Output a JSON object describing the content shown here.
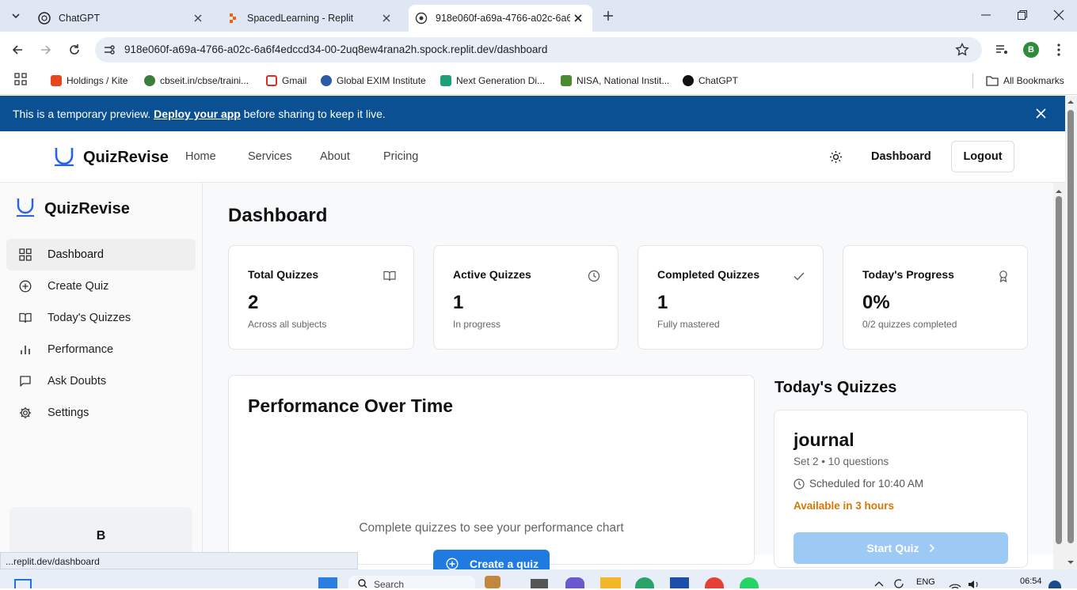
{
  "browser": {
    "tabs": [
      {
        "title": "ChatGPT",
        "icon": "chatgpt-icon"
      },
      {
        "title": "SpacedLearning - Replit",
        "icon": "replit-icon"
      },
      {
        "title": "918e060f-a69a-4766-a02c-6a6",
        "icon": "globe-icon"
      }
    ],
    "url": "918e060f-a69a-4766-a02c-6a6f4edccd34-00-2uq8ew4rana2h.spock.replit.dev/dashboard",
    "profile_initial": "B",
    "bookmarks": [
      {
        "label": "Holdings / Kite",
        "color": "#e8451e"
      },
      {
        "label": "cbseit.in/cbse/traini...",
        "color": "#3c7d3b"
      },
      {
        "label": "Gmail",
        "color": "#d93025"
      },
      {
        "label": "Global EXIM Institute",
        "color": "#2a5aa8"
      },
      {
        "label": "Next Generation Di...",
        "color": "#1aa179"
      },
      {
        "label": "NISA, National Instit...",
        "color": "#4b8b2d"
      },
      {
        "label": "ChatGPT",
        "color": "#111111"
      }
    ],
    "all_bookmarks": "All Bookmarks",
    "status_url": "...replit.dev/dashboard"
  },
  "banner": {
    "text_before": "This is a temporary preview. ",
    "link": "Deploy your app",
    "text_after": " before sharing to keep it live."
  },
  "header": {
    "brand": "QuizRevise",
    "nav": [
      "Home",
      "Services",
      "About",
      "Pricing"
    ],
    "dashboard": "Dashboard",
    "logout": "Logout"
  },
  "sidebar": {
    "brand": "QuizRevise",
    "items": [
      {
        "label": "Dashboard",
        "icon": "grid-icon"
      },
      {
        "label": "Create Quiz",
        "icon": "plus-circle-icon"
      },
      {
        "label": "Today's Quizzes",
        "icon": "book-icon"
      },
      {
        "label": "Performance",
        "icon": "bar-chart-icon"
      },
      {
        "label": "Ask Doubts",
        "icon": "message-icon"
      },
      {
        "label": "Settings",
        "icon": "gear-icon"
      }
    ],
    "user_initial": "B"
  },
  "main": {
    "title": "Dashboard",
    "stats": [
      {
        "title": "Total Quizzes",
        "value": "2",
        "sub": "Across all subjects",
        "icon": "book-icon"
      },
      {
        "title": "Active Quizzes",
        "value": "1",
        "sub": "In progress",
        "icon": "clock-icon"
      },
      {
        "title": "Completed Quizzes",
        "value": "1",
        "sub": "Fully mastered",
        "icon": "check-icon"
      },
      {
        "title": "Today's Progress",
        "value": "0%",
        "sub": "0/2 quizzes completed",
        "icon": "award-icon"
      }
    ],
    "performance": {
      "title": "Performance Over Time",
      "empty": "Complete quizzes to see your performance chart",
      "cta": "Create a quiz"
    },
    "today": {
      "title": "Today's Quizzes",
      "quiz": {
        "name": "journal",
        "meta": "Set 2 • 10 questions",
        "scheduled": "Scheduled for 10:40 AM",
        "available": "Available in 3 hours",
        "button": "Start Quiz"
      }
    }
  },
  "taskbar": {
    "search": "Search",
    "lang": "ENG",
    "time": "06:54"
  },
  "colors": {
    "banner": "#0a5092",
    "brand_blue": "#2563eb",
    "warning": "#d97706",
    "disabled_button": "#9ccaf5"
  }
}
